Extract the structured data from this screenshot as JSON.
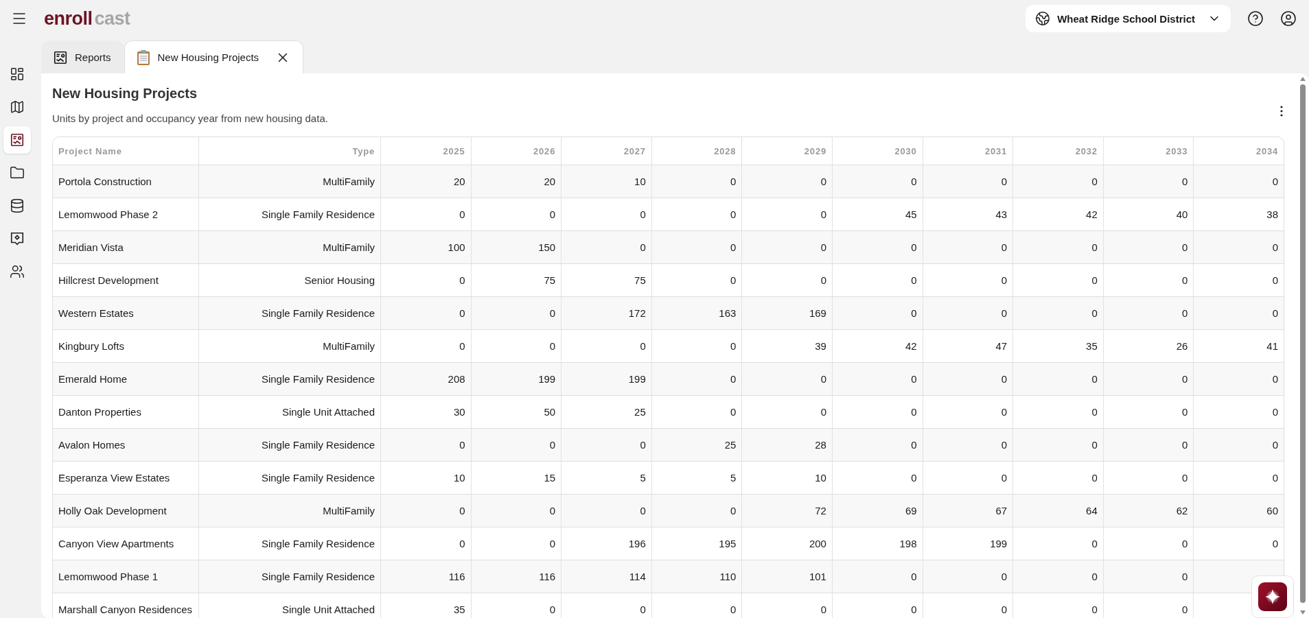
{
  "logo": {
    "primary": "enroll",
    "secondary": "cast"
  },
  "district_selector": {
    "label": "Wheat Ridge School District"
  },
  "sidebar": {
    "items": [
      {
        "kind": "dashboard",
        "selected": false
      },
      {
        "kind": "map",
        "selected": false
      },
      {
        "kind": "reports",
        "selected": true
      },
      {
        "kind": "folder",
        "selected": false
      },
      {
        "kind": "database",
        "selected": false
      },
      {
        "kind": "insights",
        "selected": false
      },
      {
        "kind": "users",
        "selected": false
      }
    ]
  },
  "tabs": [
    {
      "label": "Reports",
      "kind": "reports",
      "selected": false,
      "closable": false
    },
    {
      "label": "New Housing Projects",
      "kind": "clipboard",
      "selected": true,
      "closable": true
    }
  ],
  "report": {
    "title": "New Housing Projects",
    "subtitle": "Units by project and occupancy year from new housing data.",
    "table": {
      "columns": [
        "Project Name",
        "Type",
        "2025",
        "2026",
        "2027",
        "2028",
        "2029",
        "2030",
        "2031",
        "2032",
        "2033",
        "2034"
      ],
      "rows": [
        [
          "Portola Construction",
          "MultiFamily",
          "20",
          "20",
          "10",
          "0",
          "0",
          "0",
          "0",
          "0",
          "0",
          "0"
        ],
        [
          "Lemomwood Phase 2",
          "Single Family Residence",
          "0",
          "0",
          "0",
          "0",
          "0",
          "45",
          "43",
          "42",
          "40",
          "38"
        ],
        [
          "Meridian Vista",
          "MultiFamily",
          "100",
          "150",
          "0",
          "0",
          "0",
          "0",
          "0",
          "0",
          "0",
          "0"
        ],
        [
          "Hillcrest Development",
          "Senior Housing",
          "0",
          "75",
          "75",
          "0",
          "0",
          "0",
          "0",
          "0",
          "0",
          "0"
        ],
        [
          "Western Estates",
          "Single Family Residence",
          "0",
          "0",
          "172",
          "163",
          "169",
          "0",
          "0",
          "0",
          "0",
          "0"
        ],
        [
          "Kingbury Lofts",
          "MultiFamily",
          "0",
          "0",
          "0",
          "0",
          "39",
          "42",
          "47",
          "35",
          "26",
          "41"
        ],
        [
          "Emerald Home",
          "Single Family Residence",
          "208",
          "199",
          "199",
          "0",
          "0",
          "0",
          "0",
          "0",
          "0",
          "0"
        ],
        [
          "Danton Properties",
          "Single Unit Attached",
          "30",
          "50",
          "25",
          "0",
          "0",
          "0",
          "0",
          "0",
          "0",
          "0"
        ],
        [
          "Avalon Homes",
          "Single Family Residence",
          "0",
          "0",
          "0",
          "25",
          "28",
          "0",
          "0",
          "0",
          "0",
          "0"
        ],
        [
          "Esperanza View Estates",
          "Single Family Residence",
          "10",
          "15",
          "5",
          "5",
          "10",
          "0",
          "0",
          "0",
          "0",
          "0"
        ],
        [
          "Holly Oak Development",
          "MultiFamily",
          "0",
          "0",
          "0",
          "0",
          "72",
          "69",
          "67",
          "64",
          "62",
          "60"
        ],
        [
          "Canyon View Apartments",
          "Single Family Residence",
          "0",
          "0",
          "196",
          "195",
          "200",
          "198",
          "199",
          "0",
          "0",
          "0"
        ],
        [
          "Lemomwood Phase 1",
          "Single Family Residence",
          "116",
          "116",
          "114",
          "110",
          "101",
          "0",
          "0",
          "0",
          "0",
          null
        ],
        [
          "Marshall Canyon Residences",
          "Single Unit Attached",
          "35",
          "0",
          "0",
          "0",
          "0",
          "0",
          "0",
          "0",
          "0",
          null
        ]
      ]
    }
  }
}
